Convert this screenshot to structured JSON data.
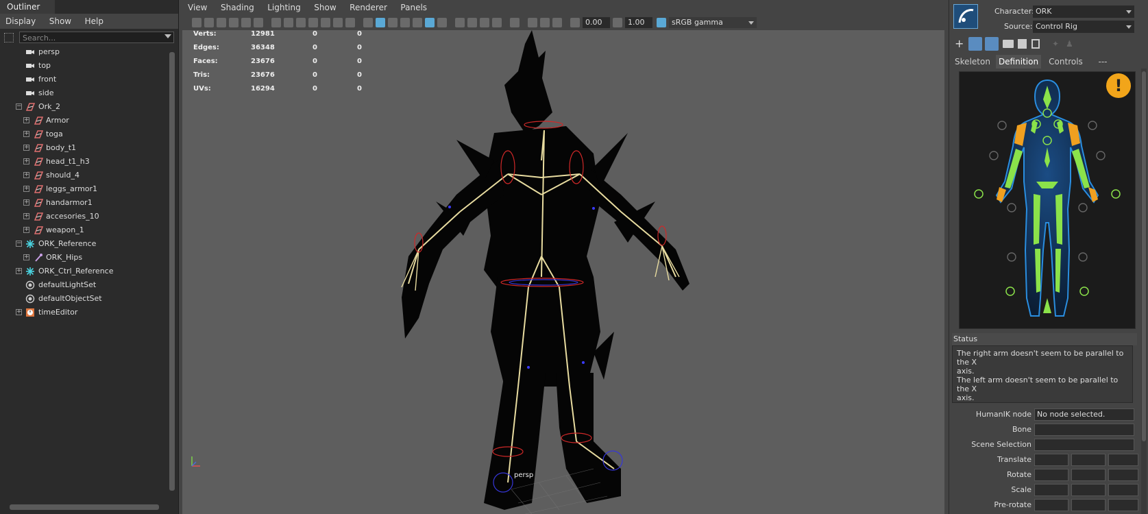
{
  "outliner": {
    "title": "Outliner",
    "menu": [
      "Display",
      "Show",
      "Help"
    ],
    "search_placeholder": "Search...",
    "items": [
      {
        "label": "persp"
      },
      {
        "label": "top"
      },
      {
        "label": "front"
      },
      {
        "label": "side"
      },
      {
        "label": "Ork_2"
      },
      {
        "label": "Armor"
      },
      {
        "label": "toga"
      },
      {
        "label": "body_t1"
      },
      {
        "label": "head_t1_h3"
      },
      {
        "label": "should_4"
      },
      {
        "label": "leggs_armor1"
      },
      {
        "label": "handarmor1"
      },
      {
        "label": "accesories_10"
      },
      {
        "label": "weapon_1"
      },
      {
        "label": "ORK_Reference"
      },
      {
        "label": "ORK_Hips"
      },
      {
        "label": "ORK_Ctrl_Reference"
      },
      {
        "label": "defaultLightSet"
      },
      {
        "label": "defaultObjectSet"
      },
      {
        "label": "timeEditor"
      }
    ]
  },
  "viewport": {
    "menu": [
      "View",
      "Shading",
      "Lighting",
      "Show",
      "Renderer",
      "Panels"
    ],
    "exposure": "0.00",
    "gamma": "1.00",
    "colorspace": "sRGB gamma",
    "camera_label": "persp",
    "hud": [
      {
        "label": "Verts:",
        "v1": "12981",
        "v2": "0",
        "v3": "0"
      },
      {
        "label": "Edges:",
        "v1": "36348",
        "v2": "0",
        "v3": "0"
      },
      {
        "label": "Faces:",
        "v1": "23676",
        "v2": "0",
        "v3": "0"
      },
      {
        "label": "Tris:",
        "v1": "23676",
        "v2": "0",
        "v3": "0"
      },
      {
        "label": "UVs:",
        "v1": "16294",
        "v2": "0",
        "v3": "0"
      }
    ]
  },
  "hik": {
    "character_label": "Character:",
    "character_value": "ORK",
    "source_label": "Source:",
    "source_value": "Control Rig",
    "tabs": [
      "Skeleton",
      "Definition",
      "Controls",
      "---"
    ],
    "active_tab": "Definition",
    "status_title": "Status",
    "status_lines": [
      "The right arm doesn't seem to be parallel to the X",
      "axis.",
      "The left arm doesn't seem to be parallel to the X",
      "axis."
    ],
    "fields": {
      "humanik_node_label": "HumanIK node",
      "humanik_node_value": "No node selected.",
      "bone_label": "Bone",
      "scene_selection_label": "Scene Selection",
      "translate_label": "Translate",
      "rotate_label": "Rotate",
      "scale_label": "Scale",
      "prerotate_label": "Pre-rotate"
    },
    "colors": {
      "accent": "#f2a51a",
      "bone_green": "#8be24a",
      "bone_orange": "#f0a020",
      "figure_blue": "#3aa7ff"
    }
  }
}
